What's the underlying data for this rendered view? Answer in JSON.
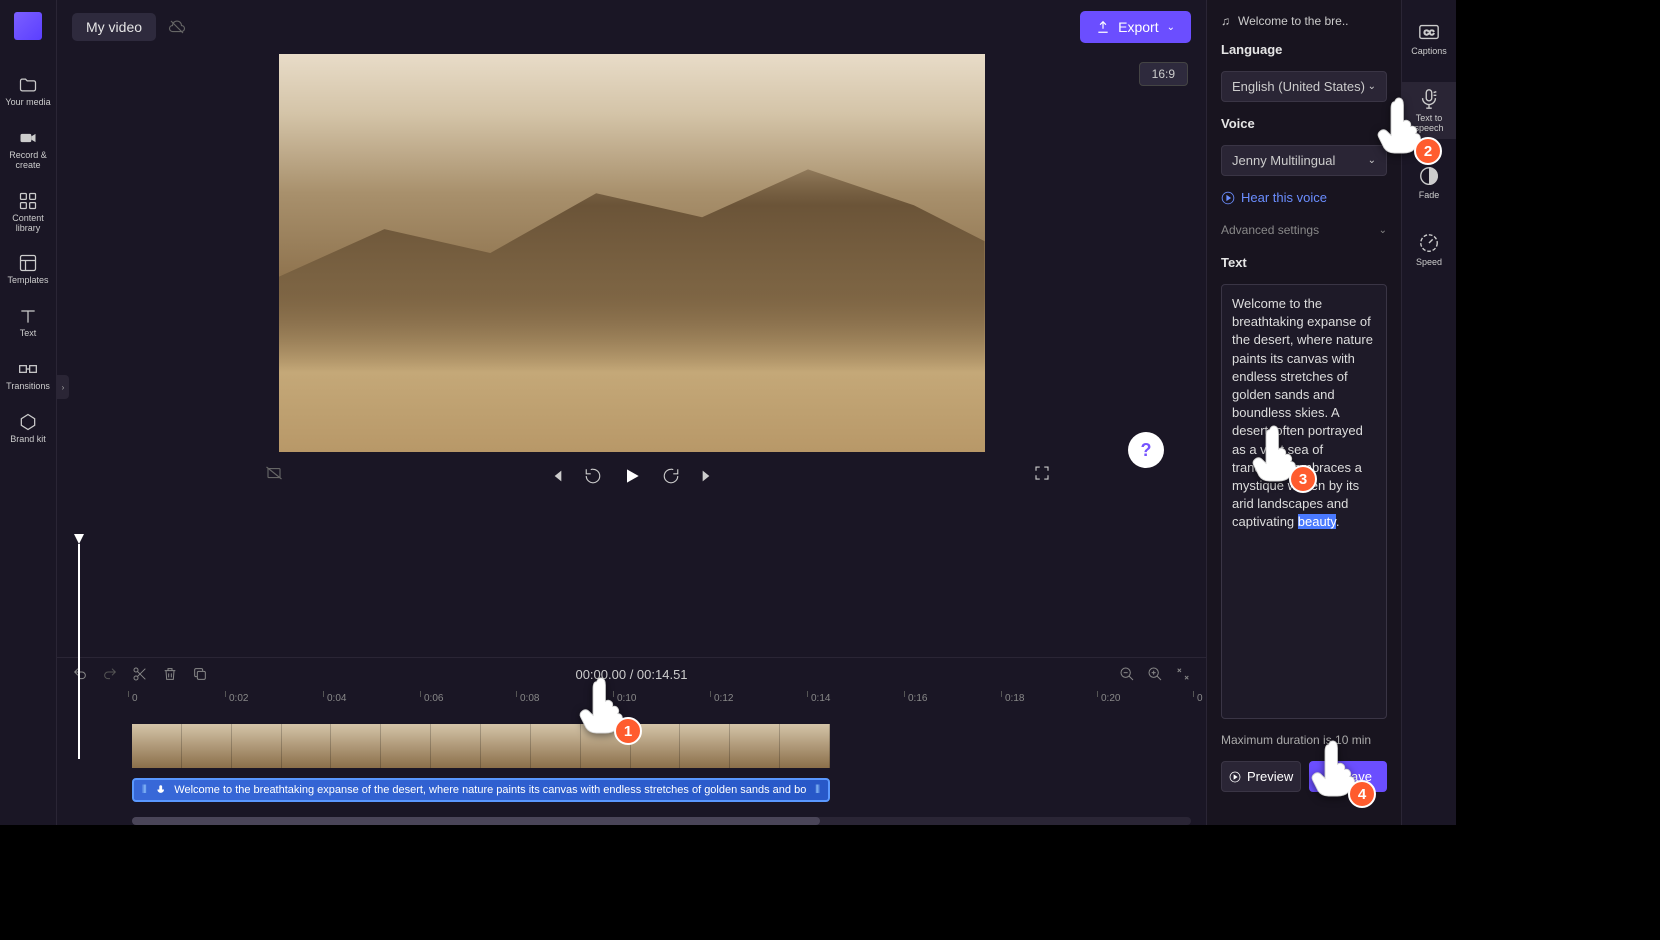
{
  "topbar": {
    "project_name": "My video",
    "export_label": "Export",
    "aspect_ratio": "16:9"
  },
  "sidebar": {
    "items": [
      {
        "label": "Your media"
      },
      {
        "label": "Record & create"
      },
      {
        "label": "Content library"
      },
      {
        "label": "Templates"
      },
      {
        "label": "Text"
      },
      {
        "label": "Transitions"
      },
      {
        "label": "Brand kit"
      }
    ]
  },
  "right_toolbar": {
    "items": [
      {
        "label": "Captions"
      },
      {
        "label": "Text to speech"
      },
      {
        "label": "Fade"
      },
      {
        "label": "Speed"
      }
    ]
  },
  "timeline": {
    "current_time": "00:00.00",
    "total_time": "00:14.51",
    "ruler_ticks": [
      "0",
      "0:02",
      "0:04",
      "0:06",
      "0:08",
      "0:10",
      "0:12",
      "0:14",
      "0:16",
      "0:18",
      "0:20",
      "0"
    ],
    "audio_track_text": "Welcome to the breathtaking expanse of the desert, where nature paints its canvas with endless stretches of golden sands and boundles"
  },
  "tts_panel": {
    "clip_title": "Welcome to the bre..",
    "language_label": "Language",
    "language_value": "English (United States)",
    "voice_label": "Voice",
    "voice_value": "Jenny Multilingual",
    "hear_voice_label": "Hear this voice",
    "advanced_label": "Advanced settings",
    "text_label": "Text",
    "text_content_pre": "Welcome to the breathtaking expanse of the desert, where nature paints its canvas with endless stretches of golden sands and boundless skies. A desert, often portrayed as a vast sea of tranquility, embraces a mystique woven by its arid landscapes and captivating ",
    "text_content_highlight": "beauty",
    "max_duration": "Maximum duration is 10 min",
    "preview_label": "Preview",
    "save_label": "Save"
  },
  "pointers": {
    "1": "1",
    "2": "2",
    "3": "3",
    "4": "4"
  }
}
